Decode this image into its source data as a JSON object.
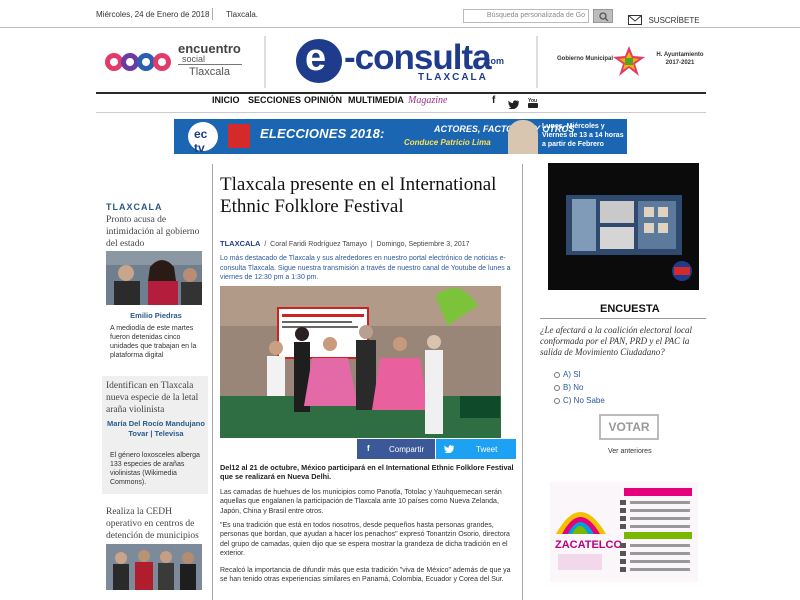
{
  "topbar": {
    "date": "Miércoles, 24 de Enero de 2018",
    "city": "Tlaxcala.",
    "search_placeholder": "Búsqueda personalizada de Go",
    "subscribe": "SUSCRÍBETE"
  },
  "header": {
    "enc_line1": "encuentro",
    "enc_line2": "social",
    "enc_line3": "Tlaxcala",
    "site_name": "-consulta",
    "site_letter": "e",
    "site_tld": ".com",
    "site_city": "TLAXCALA",
    "gov_label": "Gobierno Municipal",
    "ayuntamiento": "H. Ayuntamiento",
    "ayuntamiento_years": "2017-2021"
  },
  "nav": {
    "items": [
      "INICIO",
      "SECCIONES",
      "OPINIÓN",
      "MULTIMEDIA"
    ],
    "magazine": "Magazine"
  },
  "banner": {
    "logo": "ec tv",
    "title": "ELECCIONES 2018:",
    "subtitle": "ACTORES, FACTORES Y OTROS",
    "conductor": "Conduce Patricio Lima",
    "schedule": "Lunes, Miércoles y Viernes de 13 a 14 horas a partir de Febrero"
  },
  "left": {
    "section": "TLAXCALA",
    "items": [
      {
        "headline": "Pronto acusa de intimidación al gobierno del estado",
        "author": "Emilio Piedras",
        "text": "A mediodía de este martes fueron detenidas cinco unidades que trabajan en la plataforma digital"
      },
      {
        "headline": "Identifican en Tlaxcala nueva especie de la letal araña violinista",
        "author": "María Del Rocío Mandujano Tovar | Televisa",
        "text": "El género loxosceles alberga 133 especies de arañas violinistas (Wikimedia Commons)."
      },
      {
        "headline": "Realiza la CEDH operativo en centros de detención de municipios"
      }
    ]
  },
  "article": {
    "title": "Tlaxcala presente en el International Ethnic Folklore Festival",
    "section": "TLAXCALA",
    "author": "Coral Faridi Rodríguez Tamayo",
    "date": "Domingo, Septiembre 3, 2017",
    "lead": "Lo más destacado de Tlaxcala y sus alrededores en nuestro portal electrónico de noticias e-consulta Tlaxcala. Sigue nuestra transmisión a través de nuestro canal de Youtube de lunes a viernes de 12:30 pm a 1:30 pm.",
    "share_fb": "Compartir",
    "share_tw": "Tweet",
    "p1": "Del12 al 21 de octubre, México participará en el International Ethnic Folklore Festival que se realizará en Nueva Delhi.",
    "p2": "Las camadas de huehues de los municipios como Panotla, Totolac y Yauhquemecan serán aquellas que engalanen la participación de Tlaxcala ante 10 países como Nueva Zelanda, Japón, China y Brasil entre otros.",
    "p3": "\"Es una tradición que está en todos nosotros, desde pequeños hasta personas grandes, personas que bordan, que ayudan a hacer los penachos\" expresó Tonantzin Osorio, directora del grupo de camadas, quien dijo que se espera mostrar la grandeza de dicha tradición en el exterior.",
    "p4": "Recalcó la importancia de difundir más que esta tradición \"viva de México\" además de que ya se han tenido otras experiencias similares en Panamá, Colombia, Ecuador y Corea del Sur."
  },
  "poll": {
    "title": "ENCUESTA",
    "question": "¿Le afectará a la coalición electoral local conformada por el PAN, PRD y el PAC la salida de Movimiento Ciudadano?",
    "options": [
      "A) SI",
      "B) No",
      "C) No Sabe"
    ],
    "vote": "VOTAR",
    "previous": "Ver anteriores"
  },
  "ad": {
    "title": "ZACATELCO"
  },
  "colors": {
    "brand_blue": "#1f3c8c",
    "link_blue": "#2a5a9a",
    "facebook": "#3b5998",
    "twitter": "#1da1f2"
  }
}
